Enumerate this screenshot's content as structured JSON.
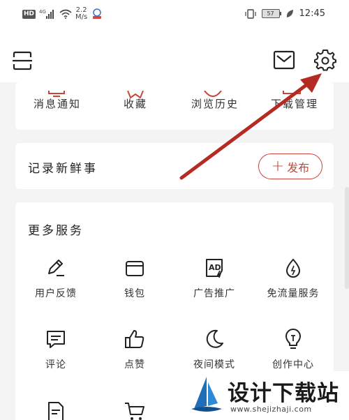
{
  "status_bar": {
    "network_badge": "HD",
    "signal_generation": "4G",
    "speed_value": "2.2",
    "speed_unit": "M/s",
    "battery": "57",
    "time": "12:45"
  },
  "header": {
    "icons": [
      "scan-icon",
      "mail-icon",
      "gear-icon"
    ]
  },
  "quick_links": [
    {
      "label": "消息通知",
      "icon": "notification-icon"
    },
    {
      "label": "收藏",
      "icon": "star-icon"
    },
    {
      "label": "浏览历史",
      "icon": "history-icon"
    },
    {
      "label": "下载管理",
      "icon": "download-icon"
    }
  ],
  "post_card": {
    "title": "记录新鲜事",
    "button_label": "发布"
  },
  "services": {
    "title": "更多服务",
    "items": [
      {
        "label": "用户反馈",
        "icon": "feedback-icon"
      },
      {
        "label": "钱包",
        "icon": "wallet-icon"
      },
      {
        "label": "广告推广",
        "icon": "ad-icon"
      },
      {
        "label": "免流量服务",
        "icon": "data-drop-icon"
      },
      {
        "label": "评论",
        "icon": "comment-icon"
      },
      {
        "label": "点赞",
        "icon": "thumbs-up-icon"
      },
      {
        "label": "夜间模式",
        "icon": "moon-icon"
      },
      {
        "label": "创作中心",
        "icon": "bulb-icon"
      },
      {
        "label": "",
        "icon": "document-icon"
      },
      {
        "label": "",
        "icon": "cart-icon"
      }
    ]
  },
  "watermark": {
    "title": "设计下载站",
    "url": "www.shejizhaji.com"
  },
  "colors": {
    "accent": "#c9453a",
    "arrow": "#b52a22"
  }
}
